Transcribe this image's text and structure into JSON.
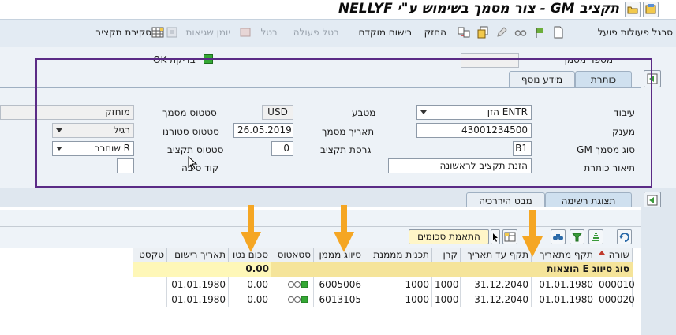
{
  "title": "תקציב GM - צור מסמך בשימוש ע\"י NELLYF",
  "toolbar": {
    "items": [
      "סרגל פעולות פועל",
      "החזק",
      "רישום מוקדם",
      "בטל פעולה",
      "בטל",
      "יומן שגיאות",
      "סקירת תקציב"
    ]
  },
  "header": {
    "doc_number_label": "מספר מסמך",
    "check_ok_label": "בדיקת OK",
    "tabs": [
      "כותרת",
      "מידע נוסף"
    ],
    "fields": {
      "processing_label": "עיבוד",
      "processing_value": "ENTR הזן",
      "grantee_label": "מענק",
      "grantee_value": "43001234500",
      "gm_doc_type_label": "סוג מסמך GM",
      "gm_doc_type_value": "B1",
      "header_desc_label": "תיאור כותרת",
      "header_desc_value": "הזנת תקציב לראשונה",
      "currency_label": "מטבע",
      "currency_value": "USD",
      "doc_date_label": "תאריך מסמך",
      "doc_date_value": "26.05.2019",
      "budget_version_label": "גרסת תקציב",
      "budget_version_value": "0",
      "reason_code_label": "קוד סיבה",
      "doc_status_label": "סטטוס מסמך",
      "doc_status_value": "מוחזק",
      "reversal_status_label": "סטטוס סטורנו",
      "reversal_status_value": "רגיל",
      "budget_status_label": "סטטוס תקציב",
      "budget_status_value": "R שוחרר"
    }
  },
  "lower": {
    "tabs": [
      "תצוגת רשימה",
      "מבט היררכיה"
    ],
    "match_amounts_label": "התאמת סכומים",
    "columns": [
      "שורה",
      "תקף מתאריך",
      "תקף עד תאריך",
      "קרן",
      "תכנית מממנת",
      "סיווג מממן",
      "סטאטוס",
      "סכום נטו",
      "תאריך רישום",
      "טקסט"
    ],
    "group_row": {
      "label": "סוג סיווג E הוצאות",
      "net_amount": "0.00"
    },
    "rows": [
      {
        "line": "000010",
        "valid_from": "01.01.1980",
        "valid_to": "31.12.2040",
        "fund": "1000",
        "funded_program": "1000",
        "funded_class": "6005006",
        "net_amount": "0.00",
        "posting_date": "01.01.1980"
      },
      {
        "line": "000020",
        "valid_from": "01.01.1980",
        "valid_to": "31.12.2040",
        "fund": "1000",
        "funded_program": "1000",
        "funded_class": "6013105",
        "net_amount": "0.00",
        "posting_date": "01.01.1980"
      }
    ]
  },
  "colors": {
    "accent_purple": "#5b2b86",
    "arrow_orange": "#f5a623",
    "group_yellow": "#fef7b8",
    "status_green": "#34a834"
  }
}
